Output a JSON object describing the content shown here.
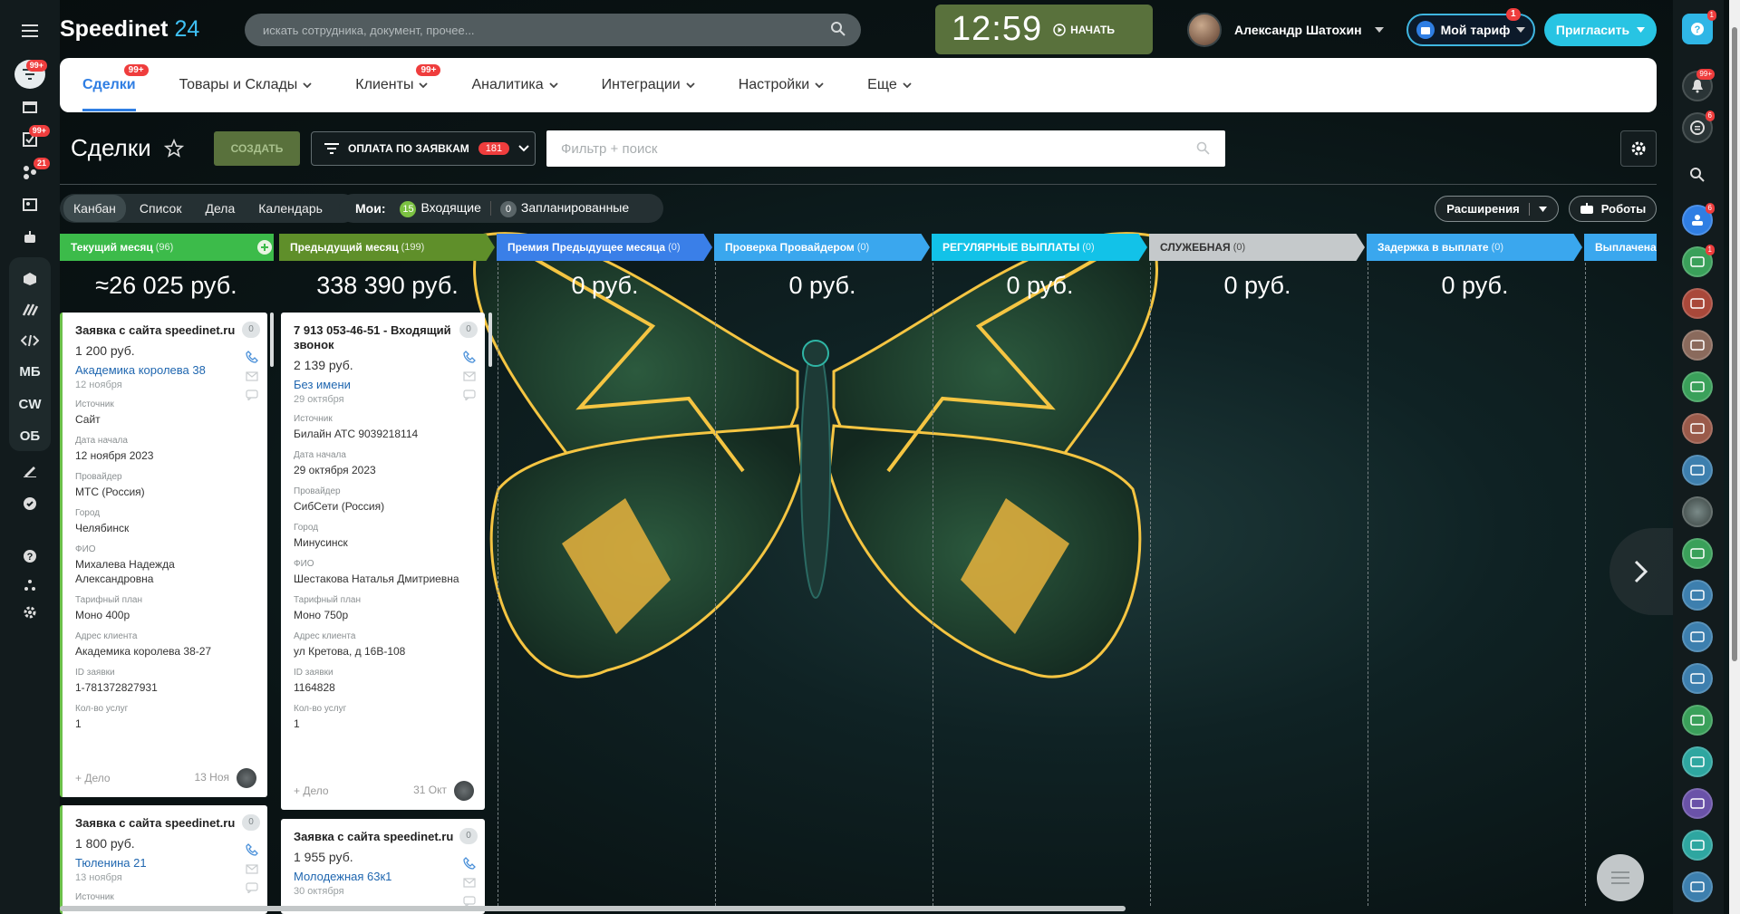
{
  "app": {
    "logo_name": "Speedinet",
    "logo_num": "24"
  },
  "search": {
    "placeholder": "искать сотрудника, документ, прочее..."
  },
  "clock": {
    "time": "12:59",
    "start_label": "НАЧАТЬ"
  },
  "user": {
    "name": "Александр Шатохин"
  },
  "plan": {
    "label": "Мой тариф",
    "badge": "1"
  },
  "invite": {
    "label": "Пригласить"
  },
  "left_sidebar": {
    "badge_filter": "99+",
    "badge_tasks": "99+",
    "badge_flow": "21",
    "items_text": [
      "МБ",
      "CW",
      "ОБ"
    ]
  },
  "nav": [
    {
      "label": "Сделки",
      "badge": "99+"
    },
    {
      "label": "Товары и Склады"
    },
    {
      "label": "Клиенты",
      "badge": "99+"
    },
    {
      "label": "Аналитика"
    },
    {
      "label": "Интеграции"
    },
    {
      "label": "Настройки"
    },
    {
      "label": "Еще"
    }
  ],
  "page": {
    "title": "Сделки",
    "create_label": "СОЗДАТЬ"
  },
  "filter": {
    "label": "ОПЛАТА ПО ЗАЯВКАМ",
    "count": "181",
    "search_placeholder": "Фильтр + поиск"
  },
  "views": [
    "Канбан",
    "Список",
    "Дела",
    "Календарь"
  ],
  "mine": {
    "label": "Мои:",
    "incoming_count": "15",
    "incoming": "Входящие",
    "planned_count": "0",
    "planned": "Запланированные"
  },
  "toolbar_right": {
    "extensions": "Расширения",
    "robots": "Роботы"
  },
  "stages": [
    {
      "name": "Текущий месяц",
      "count": "(96)",
      "color": "#3cbb4a",
      "sum": "≈26 025 руб."
    },
    {
      "name": "Предыдущий месяц",
      "count": "(199)",
      "color": "#5f8f2a",
      "sum": "338 390 руб."
    },
    {
      "name": "Премия Предыдущее месяца",
      "count": "(0)",
      "color": "#3a7fe8",
      "sum": "0 руб."
    },
    {
      "name": "Проверка Провайдером",
      "count": "(0)",
      "color": "#3aa7ee",
      "sum": "0 руб."
    },
    {
      "name": "РЕГУЛЯРНЫЕ ВЫПЛАТЫ",
      "count": "(0)",
      "color": "#12c2e8",
      "sum": "0 руб."
    },
    {
      "name": "СЛУЖЕБНАЯ",
      "count": "(0)",
      "color": "#c5c9cb",
      "sum": "0 руб."
    },
    {
      "name": "Задержка в выплате",
      "count": "(0)",
      "color": "#3aa7ee",
      "sum": "0 руб."
    },
    {
      "name": "Выплачена",
      "count": "",
      "color": "#3aa7ee",
      "sum": ""
    }
  ],
  "cards": {
    "c1": {
      "title": "Заявка с сайта speedinet.ru",
      "badge": "0",
      "price": "1 200 руб.",
      "link": "Академика королева 38",
      "date": "12 ноября",
      "fields": [
        {
          "l": "Источник",
          "v": "Сайт"
        },
        {
          "l": "Дата начала",
          "v": "12 ноября 2023"
        },
        {
          "l": "Провайдер",
          "v": "МТС (Россия)"
        },
        {
          "l": "Город",
          "v": "Челябинск"
        },
        {
          "l": "ФИО",
          "v": "Михалева Надежда Александровна"
        },
        {
          "l": "Тарифный план",
          "v": "Моно 400р"
        },
        {
          "l": "Адрес клиента",
          "v": "Академика королева 38-27"
        },
        {
          "l": "ID заявки",
          "v": "1-781372827931"
        },
        {
          "l": "Кол-во услуг",
          "v": "1"
        }
      ],
      "add": "+ Дело",
      "fdate": "13 Ноя"
    },
    "c2": {
      "title": "7 913 053-46-51 - Входящий звонок",
      "badge": "0",
      "price": "2 139 руб.",
      "link": "Без имени",
      "date": "29 октября",
      "fields": [
        {
          "l": "Источник",
          "v": "Билайн АТС 9039218114"
        },
        {
          "l": "Дата начала",
          "v": "29 октября 2023"
        },
        {
          "l": "Провайдер",
          "v": "СибСети (Россия)"
        },
        {
          "l": "Город",
          "v": "Минусинск"
        },
        {
          "l": "ФИО",
          "v": "Шестакова Наталья Дмитриевна"
        },
        {
          "l": "Тарифный план",
          "v": "Моно 750р"
        },
        {
          "l": "Адрес клиента",
          "v": "ул Кретова, д 16В-108"
        },
        {
          "l": "ID заявки",
          "v": "1164828"
        },
        {
          "l": "Кол-во услуг",
          "v": "1"
        }
      ],
      "add": "+ Дело",
      "fdate": "31 Окт"
    },
    "c3": {
      "title": "Заявка с сайта speedinet.ru",
      "badge": "0",
      "price": "1 800 руб.",
      "link": "Тюленина 21",
      "date": "13 ноября",
      "first_field": "Источник"
    },
    "c4": {
      "title": "Заявка с сайта speedinet.ru",
      "badge": "0",
      "price": "1 955 руб.",
      "link": "Молодежная 63к1",
      "date": "30 октября"
    }
  },
  "right_sidebar": {
    "help_badge": "1",
    "bell_badge": "99+",
    "chat_badge": "6",
    "group_badge": "6",
    "item_badge": "1"
  },
  "colors": {
    "accent": "#2f7ee3",
    "brand_blue": "#3fc1f5",
    "create_bg": "#59713c",
    "badge_red": "#ef3d3d"
  }
}
